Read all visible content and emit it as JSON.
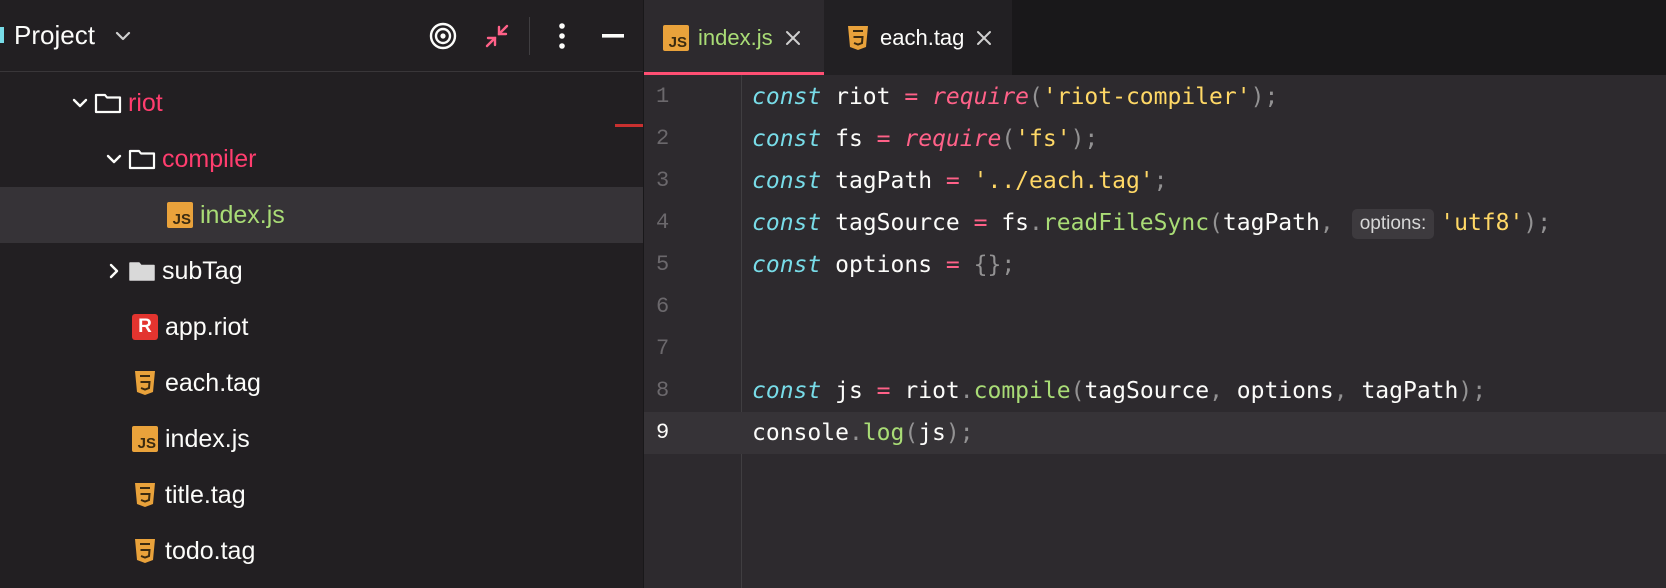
{
  "project_panel": {
    "title": "Project",
    "header_icons": [
      "locate-icon",
      "collapse-icon",
      "more-options-icon",
      "minimize-icon"
    ],
    "tree": [
      {
        "label": "riot",
        "kind": "folder",
        "expanded": true
      },
      {
        "label": "compiler",
        "kind": "folder",
        "expanded": true
      },
      {
        "label": "index.js",
        "kind": "js",
        "selected": true
      },
      {
        "label": "subTag",
        "kind": "folder",
        "expanded": false
      },
      {
        "label": "app.riot",
        "kind": "riot"
      },
      {
        "label": "each.tag",
        "kind": "html"
      },
      {
        "label": "index.js",
        "kind": "js"
      },
      {
        "label": "title.tag",
        "kind": "html"
      },
      {
        "label": "todo.tag",
        "kind": "html"
      }
    ]
  },
  "editor": {
    "tabs": [
      {
        "label": "index.js",
        "active": true
      },
      {
        "label": "each.tag",
        "active": false
      }
    ],
    "line_numbers": [
      "1",
      "2",
      "3",
      "4",
      "5",
      "6",
      "7",
      "8",
      "9"
    ],
    "current_line": 9,
    "inlay_hint": "options:",
    "tokens": {
      "const": "const",
      "require": "require",
      "eq": "=",
      "riot": "riot",
      "fs": "fs",
      "tagPath": "tagPath",
      "tagSource": "tagSource",
      "options": "options",
      "js": "js",
      "riot_compiler_str": "'riot-compiler'",
      "fs_str": "'fs'",
      "tag_path_str": "'../each.tag'",
      "utf8_str": "'utf8'",
      "readFileSync": "readFileSync",
      "compile": "compile",
      "console": "console",
      "log": "log",
      "empty_obj": "{}"
    }
  },
  "colors": {
    "accent_pink": "#ff6188",
    "keyword": "#78dce8",
    "string": "#ffd866",
    "function": "#a9dc76",
    "js_icon": "#e9a23b",
    "riot_icon": "#e3342f"
  }
}
